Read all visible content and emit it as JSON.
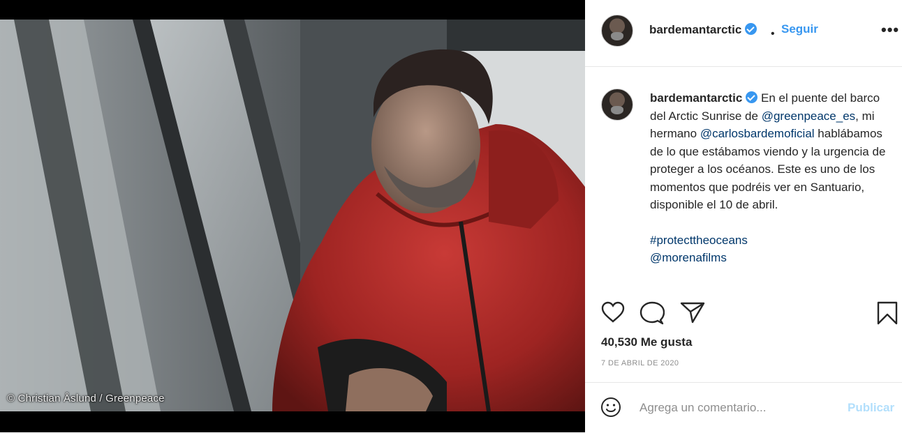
{
  "photo": {
    "credit": "© Christian Åslund / Greenpeace"
  },
  "header": {
    "username": "bardemantarctic",
    "separator": "•",
    "follow_label": "Seguir",
    "more_label": "•••"
  },
  "caption": {
    "username": "bardemantarctic",
    "text_1": "En el puente del barco del Arctic Sunrise de",
    "mention_1": "@greenpeace_es",
    "text_2": ", mi hermano",
    "mention_2": "@carlosbardemoficial",
    "text_3": "hablábamos de lo que estábamos viendo y la urgencia de proteger a los océanos. Este es uno de los momentos que podréis ver en Santuario, disponible el 10 de abril.",
    "hashtag": "#protecttheoceans",
    "mention_3": "@morenafilms"
  },
  "actions": {
    "like_icon": "heart-icon",
    "comment_icon": "comment-icon",
    "share_icon": "paper-plane-icon",
    "save_icon": "bookmark-icon"
  },
  "likes": "40,530 Me gusta",
  "date": "7 DE ABRIL DE 2020",
  "comment": {
    "placeholder": "Agrega un comentario...",
    "publish_label": "Publicar",
    "emoji_icon": "smiley-icon"
  },
  "colors": {
    "accent": "#3897f0",
    "publish_disabled": "#b2dffc",
    "link": "#00376b"
  }
}
